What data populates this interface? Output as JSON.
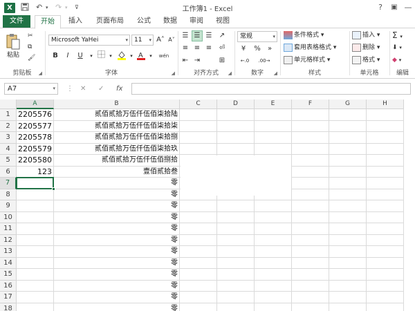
{
  "titlebar": {
    "app_icon": "X",
    "title": "工作簿1 - Excel",
    "help": "?",
    "ribbon_display": "▣",
    "minimize": "—"
  },
  "tabs": [
    {
      "label": "文件"
    },
    {
      "label": "开始"
    },
    {
      "label": "插入"
    },
    {
      "label": "页面布局"
    },
    {
      "label": "公式"
    },
    {
      "label": "数据"
    },
    {
      "label": "审阅"
    },
    {
      "label": "视图"
    }
  ],
  "ribbon": {
    "clipboard": {
      "label": "剪贴板",
      "paste": "粘贴"
    },
    "font": {
      "label": "字体",
      "name": "Microsoft YaHei",
      "size": "11",
      "grow": "A˄",
      "shrink": "A˅",
      "bold": "B",
      "italic": "I",
      "underline": "U",
      "wen": "wén"
    },
    "alignment": {
      "label": "对齐方式"
    },
    "number": {
      "label": "数字",
      "format": "常规",
      "currency": "¥",
      "percent": "%",
      "comma": "»",
      "inc_decimal": "←.0",
      "dec_decimal": ".00→"
    },
    "styles": {
      "label": "样式",
      "conditional": "条件格式",
      "table": "套用表格格式",
      "cell": "单元格样式"
    },
    "cells": {
      "label": "单元格",
      "insert": "插入",
      "delete": "删除",
      "format": "格式"
    },
    "editing": {
      "label": "编辑",
      "sum": "Σ"
    }
  },
  "formula_bar": {
    "name_box": "A7",
    "cancel": "✕",
    "enter": "✓",
    "fx": "fx",
    "value": ""
  },
  "columns": [
    "A",
    "B",
    "C",
    "D",
    "E",
    "F",
    "G",
    "H"
  ],
  "active": {
    "column": "A",
    "row": 7
  },
  "rows": [
    {
      "n": "1",
      "a": "2205576",
      "b": "贰佰贰拾万伍仟伍佰柒拾陆"
    },
    {
      "n": "2",
      "a": "2205577",
      "b": "贰佰贰拾万伍仟伍佰柒拾柒"
    },
    {
      "n": "3",
      "a": "2205578",
      "b": "贰佰贰拾万伍仟伍佰柒拾捌"
    },
    {
      "n": "4",
      "a": "2205579",
      "b": "贰佰贰拾万伍仟伍佰柒拾玖"
    },
    {
      "n": "5",
      "a": "2205580",
      "b": "贰佰贰拾万伍仟伍佰捌拾"
    },
    {
      "n": "6",
      "a": "123",
      "b": "壹佰贰拾叁"
    },
    {
      "n": "7",
      "a": "",
      "b": "零"
    },
    {
      "n": "8",
      "a": "",
      "b": "零"
    },
    {
      "n": "9",
      "a": "",
      "b": "零"
    },
    {
      "n": "10",
      "a": "",
      "b": "零"
    },
    {
      "n": "11",
      "a": "",
      "b": "零"
    },
    {
      "n": "12",
      "a": "",
      "b": "零"
    },
    {
      "n": "13",
      "a": "",
      "b": "零"
    },
    {
      "n": "14",
      "a": "",
      "b": "零"
    },
    {
      "n": "15",
      "a": "",
      "b": "零"
    },
    {
      "n": "16",
      "a": "",
      "b": "零"
    },
    {
      "n": "17",
      "a": "",
      "b": "零"
    },
    {
      "n": "18",
      "a": "",
      "b": "零"
    }
  ]
}
